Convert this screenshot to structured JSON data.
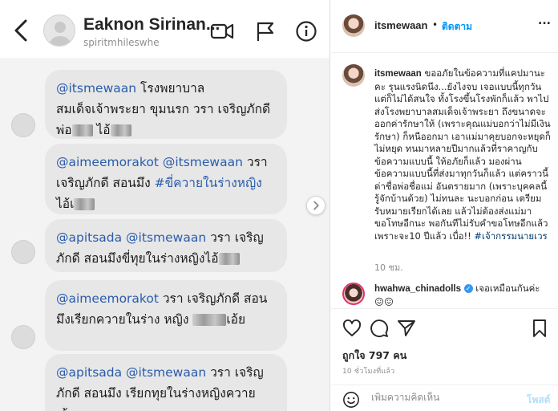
{
  "dm": {
    "contact_name": "Eaknon Sirinan...",
    "contact_username": "spiritmhileswhe",
    "messages": [
      {
        "mention": "@itsmewaan",
        "text": " โรงพยาบาล สมเด็จเจ้าพระยา ขุมนรก วรา เจริญภักดี พ่อ",
        "after_blur": " ไอ้"
      },
      {
        "mention": "@aimeemorakot @itsmewaan",
        "text": " วรา เจริญภักดี สอนมึง ",
        "tag": "#ขี่ควายในร่างหญิง",
        "after": " ไอ้เ"
      },
      {
        "mention": "@apitsada @itsmewaan",
        "text": " วรา เจริญภักดี สอนมึงขี่ทุยในร่างหญิงไอ้"
      },
      {
        "mention": "@aimeemorakot",
        "text": " วรา เจริญภักดี สอนมึงเรียกควายในร่าง หญิง",
        "after_blur": "เอ้ย"
      },
      {
        "mention": "@apitsada @itsmewaan",
        "text": " วรา เจริญ ภักดี สอนมึง เรียกทุยในร่างหญิงควาย เอ้ย"
      }
    ]
  },
  "post": {
    "owner_username": "itsmewaan",
    "separator": "•",
    "follow_label": "ติดตาม",
    "more_label": "...",
    "caption_username": "itsmewaan",
    "caption_text": " ขออภัยในข้อความที่แคปมานะคะ รุนแรงนิดนึง...ยังไงจบ เจอแบบนี้ทุกวันแต่ก็ไม่ได้สนใจ ทั้งโรงขึ้นโรงพักก็แล้ว พาไปส่งโรงพยาบาลสมเด็จเจ้าพระยา ถึงขนาดจะออกค่ารักษาให้ (เพราะคุณแม่บอกว่าไม่มีเงินรักษา) ก็หนีออกมา เอาแม่มาคุยบอกจะหยุดก็ไม่หยุด ทนมาหลายปีมากแล้วที่ราคาญกับข้อความแบบนี้ ให้อภัยก็แล้ว มองผ่านข้อความแบบนี้ที่ส่งมาทุกวันก็แล้ว แต่คราวนี้ด่าชื่อพ่อชื่อแม่ อันตรายมาก (เพราะบุคคลนี้รู้จักบ้านด้วย) ไม่ทนละ นะบอกก่อน เตรียมรับหมายเรียกได้เลย แล้วไม่ต้องส่งแม่มาขอโทษอีกนะ พอกันทีไม่รับคำขอโทษอีกแล้วเพราะจะ10 ปีแล้ว เบื่อ!! ",
    "caption_hashtag": "#เจ้ากรรมนายเวร",
    "caption_time": "10 ชม.",
    "comment_username": "hwahwa_chinadolls",
    "comment_text": " เจอเหมือนกันค่ะ 😖😖",
    "likes": "ถูกใจ 797 คน",
    "posted_time": "10 ชั่วโมงที่แล้ว",
    "comment_placeholder": "เพิ่มความคิดเห็น",
    "post_label": "โพสต์"
  },
  "colors": {
    "mention": "#2a5cab",
    "link": "#0095f6",
    "bubble": "#e7e7e7"
  },
  "icons": [
    "back-arrow-icon",
    "video-call-icon",
    "flag-icon",
    "info-icon",
    "heart-icon",
    "comment-icon",
    "share-icon",
    "bookmark-icon",
    "emoji-icon",
    "chevron-right-icon"
  ]
}
